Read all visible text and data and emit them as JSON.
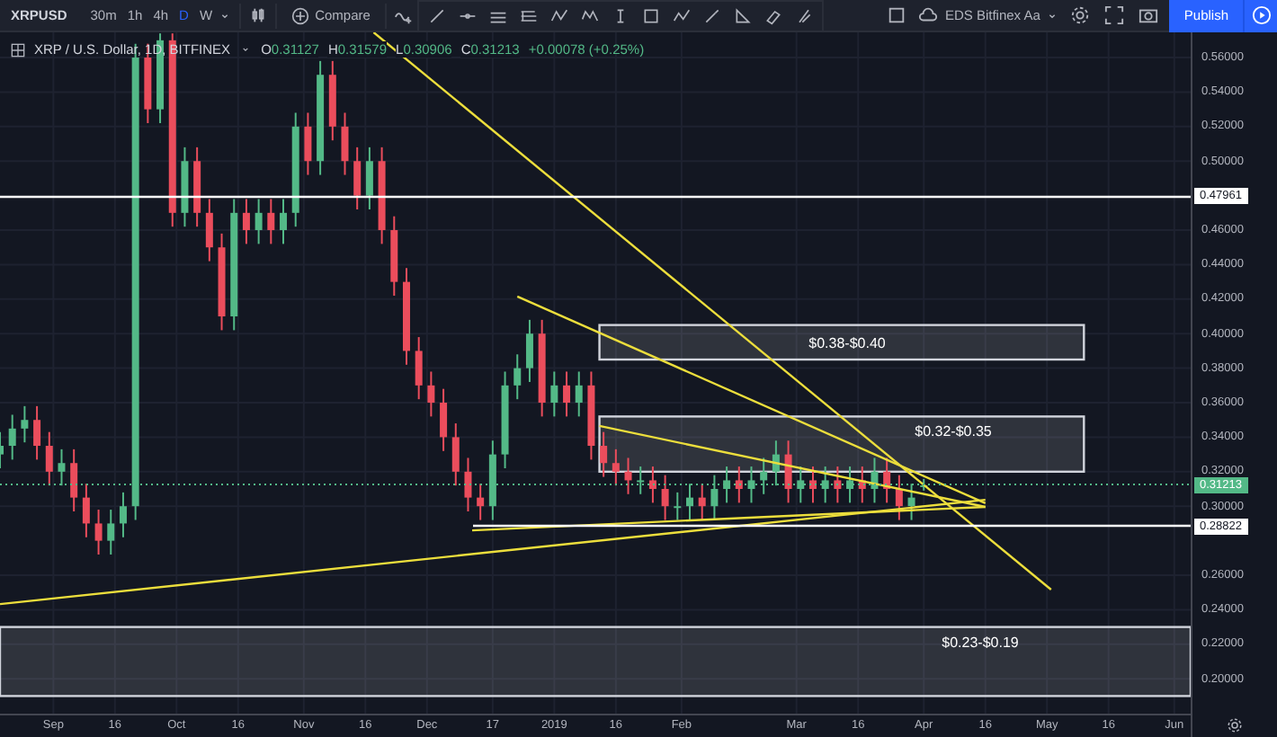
{
  "toolbar": {
    "symbol": "XRPUSD",
    "intervals": [
      {
        "label": "30m",
        "selected": false
      },
      {
        "label": "1h",
        "selected": false
      },
      {
        "label": "4h",
        "selected": false
      },
      {
        "label": "D",
        "selected": true
      },
      {
        "label": "W",
        "selected": false
      }
    ],
    "compare": "Compare",
    "layout_name": "EDS Bitfinex Aa",
    "publish": "Publish"
  },
  "legend": {
    "title": "XRP / U.S. Dollar, 1D, BITFINEX",
    "ohlc": [
      {
        "key": "O",
        "value": "0.31127"
      },
      {
        "key": "H",
        "value": "0.31579"
      },
      {
        "key": "L",
        "value": "0.30906"
      },
      {
        "key": "C",
        "value": "0.31213"
      }
    ],
    "change": "+0.00078 (+0.25%)"
  },
  "chart": {
    "chart_data": {
      "type": "candlestick",
      "grid": true,
      "xlim": [
        "2018-08-19",
        "2019-06-05"
      ],
      "ylim": [
        0.1798,
        0.5746
      ],
      "x": [
        "2018-08-19",
        "2018-08-22",
        "2018-08-25",
        "2018-08-28",
        "2018-08-31",
        "2018-09-03",
        "2018-09-06",
        "2018-09-09",
        "2018-09-12",
        "2018-09-15",
        "2018-09-18",
        "2018-09-21",
        "2018-09-24",
        "2018-09-27",
        "2018-09-30",
        "2018-10-03",
        "2018-10-06",
        "2018-10-09",
        "2018-10-12",
        "2018-10-15",
        "2018-10-18",
        "2018-10-21",
        "2018-10-24",
        "2018-10-27",
        "2018-10-30",
        "2018-11-02",
        "2018-11-05",
        "2018-11-08",
        "2018-11-11",
        "2018-11-14",
        "2018-11-17",
        "2018-11-20",
        "2018-11-23",
        "2018-11-26",
        "2018-11-29",
        "2018-12-02",
        "2018-12-05",
        "2018-12-08",
        "2018-12-11",
        "2018-12-14",
        "2018-12-17",
        "2018-12-20",
        "2018-12-23",
        "2018-12-26",
        "2018-12-29",
        "2019-01-01",
        "2019-01-04",
        "2019-01-07",
        "2019-01-10",
        "2019-01-13",
        "2019-01-16",
        "2019-01-19",
        "2019-01-22",
        "2019-01-25",
        "2019-01-28",
        "2019-01-31",
        "2019-02-03",
        "2019-02-06",
        "2019-02-09",
        "2019-02-12",
        "2019-02-15",
        "2019-02-18",
        "2019-02-21",
        "2019-02-24",
        "2019-02-27",
        "2019-03-02",
        "2019-03-05",
        "2019-03-08",
        "2019-03-11",
        "2019-03-14",
        "2019-03-17",
        "2019-03-20",
        "2019-03-23",
        "2019-03-26",
        "2019-03-29",
        "2019-04-01"
      ],
      "ohlc": [
        [
          0.33,
          0.343,
          0.322,
          0.335
        ],
        [
          0.335,
          0.353,
          0.327,
          0.345
        ],
        [
          0.345,
          0.358,
          0.337,
          0.35
        ],
        [
          0.35,
          0.358,
          0.327,
          0.335
        ],
        [
          0.335,
          0.343,
          0.312,
          0.32
        ],
        [
          0.32,
          0.333,
          0.312,
          0.325
        ],
        [
          0.325,
          0.333,
          0.297,
          0.305
        ],
        [
          0.305,
          0.313,
          0.282,
          0.29
        ],
        [
          0.29,
          0.298,
          0.272,
          0.28
        ],
        [
          0.28,
          0.298,
          0.272,
          0.29
        ],
        [
          0.29,
          0.308,
          0.282,
          0.3
        ],
        [
          0.3,
          0.568,
          0.292,
          0.56
        ],
        [
          0.56,
          0.568,
          0.522,
          0.53
        ],
        [
          0.53,
          0.574,
          0.522,
          0.57
        ],
        [
          0.57,
          0.574,
          0.462,
          0.47
        ],
        [
          0.47,
          0.508,
          0.462,
          0.5
        ],
        [
          0.5,
          0.508,
          0.462,
          0.47
        ],
        [
          0.47,
          0.478,
          0.442,
          0.45
        ],
        [
          0.45,
          0.458,
          0.402,
          0.41
        ],
        [
          0.41,
          0.478,
          0.402,
          0.47
        ],
        [
          0.47,
          0.478,
          0.452,
          0.46
        ],
        [
          0.46,
          0.478,
          0.452,
          0.47
        ],
        [
          0.47,
          0.478,
          0.452,
          0.46
        ],
        [
          0.46,
          0.478,
          0.452,
          0.47
        ],
        [
          0.47,
          0.528,
          0.462,
          0.52
        ],
        [
          0.52,
          0.528,
          0.492,
          0.5
        ],
        [
          0.5,
          0.558,
          0.492,
          0.55
        ],
        [
          0.55,
          0.558,
          0.512,
          0.52
        ],
        [
          0.52,
          0.528,
          0.492,
          0.5
        ],
        [
          0.5,
          0.508,
          0.472,
          0.48
        ],
        [
          0.48,
          0.508,
          0.472,
          0.5
        ],
        [
          0.5,
          0.508,
          0.452,
          0.46
        ],
        [
          0.46,
          0.468,
          0.422,
          0.43
        ],
        [
          0.43,
          0.438,
          0.382,
          0.39
        ],
        [
          0.39,
          0.398,
          0.362,
          0.37
        ],
        [
          0.37,
          0.378,
          0.352,
          0.36
        ],
        [
          0.36,
          0.368,
          0.332,
          0.34
        ],
        [
          0.34,
          0.348,
          0.312,
          0.32
        ],
        [
          0.32,
          0.328,
          0.297,
          0.305
        ],
        [
          0.305,
          0.313,
          0.292,
          0.3
        ],
        [
          0.3,
          0.338,
          0.292,
          0.33
        ],
        [
          0.33,
          0.378,
          0.322,
          0.37
        ],
        [
          0.37,
          0.388,
          0.362,
          0.38
        ],
        [
          0.38,
          0.408,
          0.372,
          0.4
        ],
        [
          0.4,
          0.408,
          0.352,
          0.36
        ],
        [
          0.36,
          0.378,
          0.352,
          0.37
        ],
        [
          0.37,
          0.378,
          0.352,
          0.36
        ],
        [
          0.36,
          0.378,
          0.352,
          0.37
        ],
        [
          0.37,
          0.378,
          0.327,
          0.335
        ],
        [
          0.335,
          0.343,
          0.317,
          0.325
        ],
        [
          0.325,
          0.333,
          0.312,
          0.32
        ],
        [
          0.32,
          0.328,
          0.307,
          0.315
        ],
        [
          0.315,
          0.323,
          0.307,
          0.315
        ],
        [
          0.315,
          0.323,
          0.302,
          0.31
        ],
        [
          0.31,
          0.318,
          0.292,
          0.3
        ],
        [
          0.3,
          0.308,
          0.292,
          0.3
        ],
        [
          0.3,
          0.313,
          0.292,
          0.305
        ],
        [
          0.305,
          0.313,
          0.292,
          0.3
        ],
        [
          0.3,
          0.318,
          0.292,
          0.31
        ],
        [
          0.31,
          0.323,
          0.302,
          0.315
        ],
        [
          0.315,
          0.323,
          0.302,
          0.31
        ],
        [
          0.31,
          0.323,
          0.302,
          0.315
        ],
        [
          0.315,
          0.328,
          0.307,
          0.32
        ],
        [
          0.32,
          0.338,
          0.312,
          0.33
        ],
        [
          0.33,
          0.338,
          0.302,
          0.31
        ],
        [
          0.31,
          0.323,
          0.302,
          0.315
        ],
        [
          0.315,
          0.323,
          0.302,
          0.31
        ],
        [
          0.31,
          0.323,
          0.302,
          0.315
        ],
        [
          0.315,
          0.323,
          0.302,
          0.31
        ],
        [
          0.31,
          0.323,
          0.302,
          0.315
        ],
        [
          0.315,
          0.323,
          0.302,
          0.31
        ],
        [
          0.31,
          0.328,
          0.302,
          0.32
        ],
        [
          0.32,
          0.328,
          0.302,
          0.31
        ],
        [
          0.31,
          0.318,
          0.292,
          0.3
        ],
        [
          0.3,
          0.313,
          0.292,
          0.305
        ],
        [
          0.31127,
          0.31579,
          0.30906,
          0.31213
        ]
      ],
      "xticks": [
        {
          "value": "2018-09-01",
          "label": "Sep"
        },
        {
          "value": "2018-09-16",
          "label": "16"
        },
        {
          "value": "2018-10-01",
          "label": "Oct"
        },
        {
          "value": "2018-10-16",
          "label": "16"
        },
        {
          "value": "2018-11-01",
          "label": "Nov"
        },
        {
          "value": "2018-11-16",
          "label": "16"
        },
        {
          "value": "2018-12-01",
          "label": "Dec"
        },
        {
          "value": "2018-12-17",
          "label": "17"
        },
        {
          "value": "2019-01-01",
          "label": "2019"
        },
        {
          "value": "2019-01-16",
          "label": "16"
        },
        {
          "value": "2019-02-01",
          "label": "Feb"
        },
        {
          "value": "2019-03-01",
          "label": "Mar"
        },
        {
          "value": "2019-03-16",
          "label": "16"
        },
        {
          "value": "2019-04-01",
          "label": "Apr"
        },
        {
          "value": "2019-04-16",
          "label": "16"
        },
        {
          "value": "2019-05-01",
          "label": "May"
        },
        {
          "value": "2019-05-16",
          "label": "16"
        },
        {
          "value": "2019-06-01",
          "label": "Jun"
        }
      ],
      "yticks": [
        {
          "value": 0.56,
          "label": "0.56000"
        },
        {
          "value": 0.54,
          "label": "0.54000"
        },
        {
          "value": 0.52,
          "label": "0.52000"
        },
        {
          "value": 0.5,
          "label": "0.50000"
        },
        {
          "value": 0.46,
          "label": "0.46000"
        },
        {
          "value": 0.44,
          "label": "0.44000"
        },
        {
          "value": 0.42,
          "label": "0.42000"
        },
        {
          "value": 0.4,
          "label": "0.40000"
        },
        {
          "value": 0.38,
          "label": "0.38000"
        },
        {
          "value": 0.36,
          "label": "0.36000"
        },
        {
          "value": 0.34,
          "label": "0.34000"
        },
        {
          "value": 0.32,
          "label": "0.32000"
        },
        {
          "value": 0.3,
          "label": "0.30000"
        },
        {
          "value": 0.26,
          "label": "0.26000"
        },
        {
          "value": 0.24,
          "label": "0.24000"
        },
        {
          "value": 0.22,
          "label": "0.22000"
        },
        {
          "value": 0.2,
          "label": "0.20000"
        }
      ]
    },
    "drawings": [
      {
        "kind": "price_line",
        "label": "0.47961"
      },
      {
        "kind": "last_price",
        "label": "0.31213"
      },
      {
        "kind": "price_line",
        "label": "0.28822"
      },
      {
        "kind": "box",
        "label": "$0.38-$0.40"
      },
      {
        "kind": "box",
        "label": "$0.32-$0.35"
      },
      {
        "kind": "box",
        "label": "$0.23-$0.19"
      }
    ]
  }
}
